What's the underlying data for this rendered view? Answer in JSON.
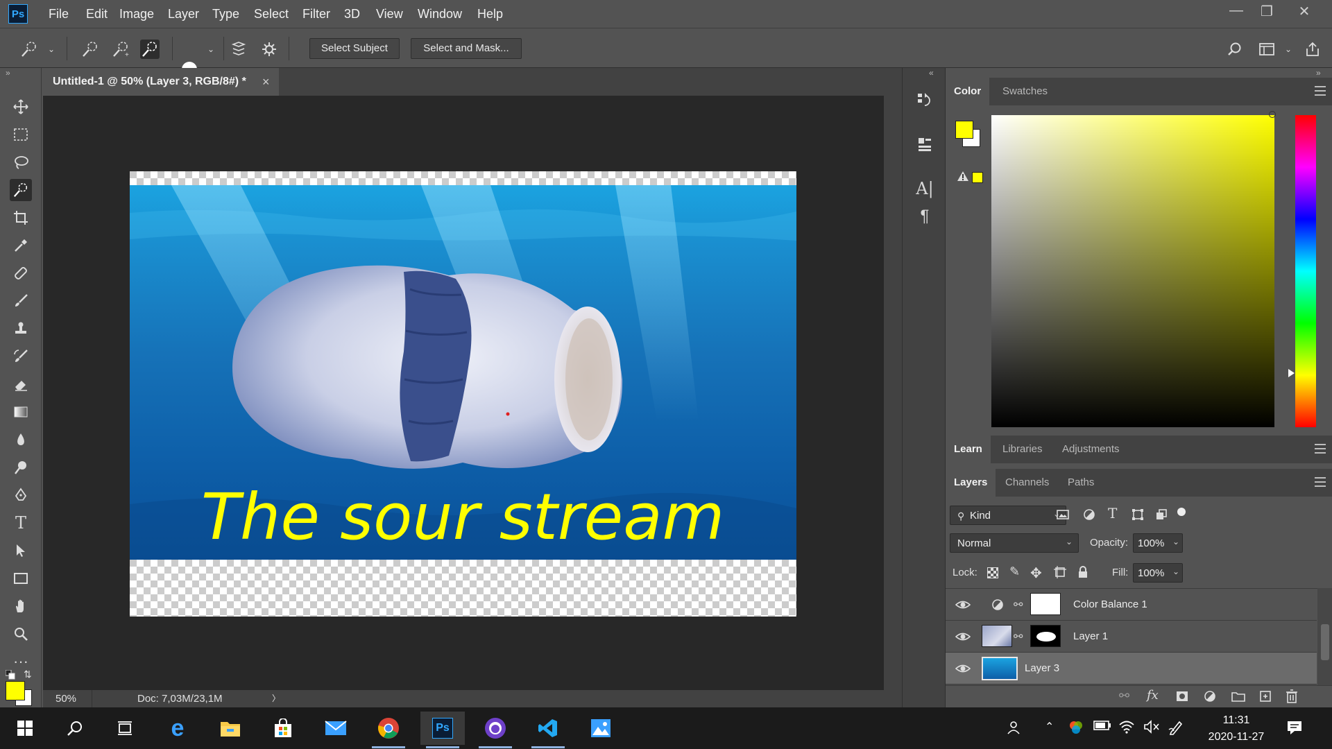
{
  "app": {
    "logo_text": "Ps"
  },
  "menu": [
    "File",
    "Edit",
    "Image",
    "Layer",
    "Type",
    "Select",
    "Filter",
    "3D",
    "View",
    "Window",
    "Help"
  ],
  "options": {
    "brush_size": "30",
    "select_subject": "Select Subject",
    "select_and_mask": "Select and Mask..."
  },
  "document": {
    "tab_title": "Untitled-1 @ 50% (Layer 3, RGB/8#) *",
    "close_glyph": "×",
    "canvas_text": "The sour stream",
    "canvas_text_color": "#ffff00"
  },
  "status": {
    "zoom": "50%",
    "doc_info": "Doc: 7,03M/23,1M",
    "arrow": "〉"
  },
  "color_panel": {
    "tabs": [
      "Color",
      "Swatches"
    ],
    "foreground": "#ffff00",
    "background": "#ffffff"
  },
  "learn_tabs": [
    "Learn",
    "Libraries",
    "Adjustments"
  ],
  "layers_panel": {
    "tabs": [
      "Layers",
      "Channels",
      "Paths"
    ],
    "kind_label": "Kind",
    "blend_mode": "Normal",
    "opacity_label": "Opacity:",
    "opacity_value": "100%",
    "lock_label": "Lock:",
    "fill_label": "Fill:",
    "fill_value": "100%",
    "layers": [
      {
        "name": "Color Balance 1"
      },
      {
        "name": "Layer 1"
      },
      {
        "name": "Layer 3"
      }
    ]
  },
  "taskbar": {
    "time": "11:31",
    "date": "2020-11-27"
  },
  "colors": {
    "accent": "#31a8ff",
    "ui_bg": "#535353",
    "panel_dark": "#424242",
    "canvas_bg": "#282828"
  }
}
